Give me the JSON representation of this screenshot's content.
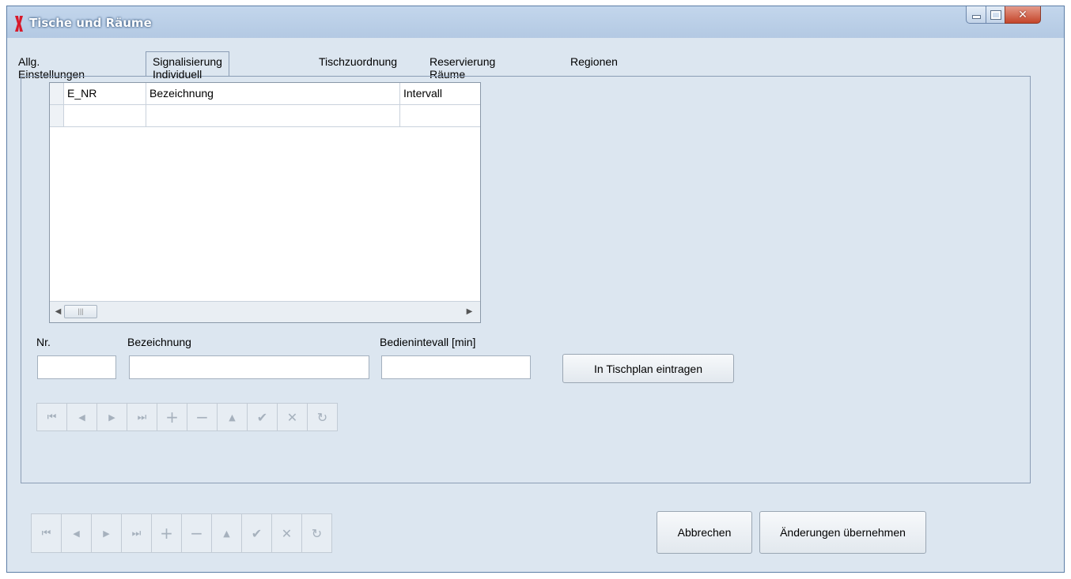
{
  "window": {
    "title": "Tische und Räume",
    "controls": {
      "minimize": "—",
      "maximize": "▫",
      "close": "✕"
    }
  },
  "tabs": [
    {
      "label": "Allg. Einstellungen",
      "active": false
    },
    {
      "label": "Signalisierung Individuell",
      "active": true
    },
    {
      "label": "Tischzuordnung",
      "active": false
    },
    {
      "label": "Reservierung Räume",
      "active": false
    },
    {
      "label": "Regionen",
      "active": false
    }
  ],
  "grid": {
    "columns": [
      "E_NR",
      "Bezeichnung",
      "Intervall"
    ],
    "rows": [
      [
        "",
        "",
        ""
      ]
    ],
    "scroll": {
      "left_icon": "◀",
      "right_icon": "▶",
      "thumb_grip": "|||"
    }
  },
  "form": {
    "nr": {
      "label": "Nr.",
      "value": ""
    },
    "bezeichnung": {
      "label": "Bezeichnung",
      "value": ""
    },
    "intervall": {
      "label": "Bedienintevall [min]",
      "value": ""
    },
    "tischplan_button": "In Tischplan eintragen"
  },
  "navigator": {
    "icons": [
      "first-icon",
      "prior-icon",
      "next-icon",
      "last-icon",
      "insert-icon",
      "delete-icon",
      "edit-icon",
      "post-icon",
      "cancel-icon",
      "refresh-icon"
    ],
    "glyphs": [
      "⏮",
      "◀",
      "▶",
      "⏭",
      "+",
      "−",
      "▲",
      "✔",
      "✕",
      "↻"
    ]
  },
  "footer": {
    "cancel": "Abbrechen",
    "apply": "Änderungen übernehmen"
  },
  "colors": {
    "titlebar": "#b8cde6",
    "client": "#dce6f0",
    "close_button": "#c94f36",
    "app_icon": "#d7192a"
  }
}
